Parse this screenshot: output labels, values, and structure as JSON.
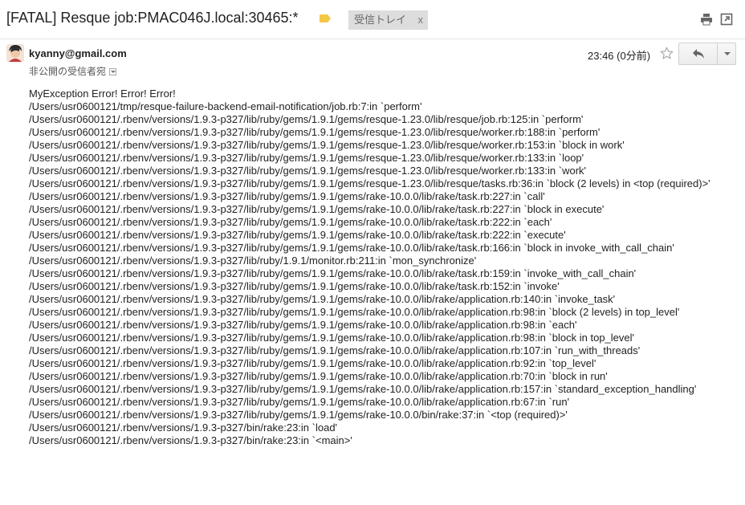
{
  "header": {
    "subject": "[FATAL] Resque job:PMAC046J.local:30465:*",
    "label_chip": "受信トレイ",
    "label_chip_close": "x",
    "colors": {
      "label_tag": "#f6c744",
      "chip_bg": "#dddddd"
    }
  },
  "toolbar": {
    "print_icon": "print-icon",
    "newwin_icon": "open-in-new-window-icon"
  },
  "message": {
    "sender": "kyanny@gmail.com",
    "recipient": "非公開の受信者宛",
    "timestamp": "23:46 (0分前)",
    "star_icon": "star-outline-icon",
    "reply_icon": "reply-arrow-icon",
    "more_icon": "chevron-down-icon",
    "body_lines": [
      "MyException Error! Error! Error!",
      "/Users/usr0600121/tmp/resque-failure-backend-email-notification/job.rb:7:in `perform'",
      "/Users/usr0600121/.rbenv/versions/1.9.3-p327/lib/ruby/gems/1.9.1/gems/resque-1.23.0/lib/resque/job.rb:125:in `perform'",
      "/Users/usr0600121/.rbenv/versions/1.9.3-p327/lib/ruby/gems/1.9.1/gems/resque-1.23.0/lib/resque/worker.rb:188:in `perform'",
      "/Users/usr0600121/.rbenv/versions/1.9.3-p327/lib/ruby/gems/1.9.1/gems/resque-1.23.0/lib/resque/worker.rb:153:in `block in work'",
      "/Users/usr0600121/.rbenv/versions/1.9.3-p327/lib/ruby/gems/1.9.1/gems/resque-1.23.0/lib/resque/worker.rb:133:in `loop'",
      "/Users/usr0600121/.rbenv/versions/1.9.3-p327/lib/ruby/gems/1.9.1/gems/resque-1.23.0/lib/resque/worker.rb:133:in `work'",
      "/Users/usr0600121/.rbenv/versions/1.9.3-p327/lib/ruby/gems/1.9.1/gems/resque-1.23.0/lib/resque/tasks.rb:36:in `block (2 levels) in <top (required)>'",
      "/Users/usr0600121/.rbenv/versions/1.9.3-p327/lib/ruby/gems/1.9.1/gems/rake-10.0.0/lib/rake/task.rb:227:in `call'",
      "/Users/usr0600121/.rbenv/versions/1.9.3-p327/lib/ruby/gems/1.9.1/gems/rake-10.0.0/lib/rake/task.rb:227:in `block in execute'",
      "/Users/usr0600121/.rbenv/versions/1.9.3-p327/lib/ruby/gems/1.9.1/gems/rake-10.0.0/lib/rake/task.rb:222:in `each'",
      "/Users/usr0600121/.rbenv/versions/1.9.3-p327/lib/ruby/gems/1.9.1/gems/rake-10.0.0/lib/rake/task.rb:222:in `execute'",
      "/Users/usr0600121/.rbenv/versions/1.9.3-p327/lib/ruby/gems/1.9.1/gems/rake-10.0.0/lib/rake/task.rb:166:in `block in invoke_with_call_chain'",
      "/Users/usr0600121/.rbenv/versions/1.9.3-p327/lib/ruby/1.9.1/monitor.rb:211:in `mon_synchronize'",
      "/Users/usr0600121/.rbenv/versions/1.9.3-p327/lib/ruby/gems/1.9.1/gems/rake-10.0.0/lib/rake/task.rb:159:in `invoke_with_call_chain'",
      "/Users/usr0600121/.rbenv/versions/1.9.3-p327/lib/ruby/gems/1.9.1/gems/rake-10.0.0/lib/rake/task.rb:152:in `invoke'",
      "/Users/usr0600121/.rbenv/versions/1.9.3-p327/lib/ruby/gems/1.9.1/gems/rake-10.0.0/lib/rake/application.rb:140:in `invoke_task'",
      "/Users/usr0600121/.rbenv/versions/1.9.3-p327/lib/ruby/gems/1.9.1/gems/rake-10.0.0/lib/rake/application.rb:98:in `block (2 levels) in top_level'",
      "/Users/usr0600121/.rbenv/versions/1.9.3-p327/lib/ruby/gems/1.9.1/gems/rake-10.0.0/lib/rake/application.rb:98:in `each'",
      "/Users/usr0600121/.rbenv/versions/1.9.3-p327/lib/ruby/gems/1.9.1/gems/rake-10.0.0/lib/rake/application.rb:98:in `block in top_level'",
      "/Users/usr0600121/.rbenv/versions/1.9.3-p327/lib/ruby/gems/1.9.1/gems/rake-10.0.0/lib/rake/application.rb:107:in `run_with_threads'",
      "/Users/usr0600121/.rbenv/versions/1.9.3-p327/lib/ruby/gems/1.9.1/gems/rake-10.0.0/lib/rake/application.rb:92:in `top_level'",
      "/Users/usr0600121/.rbenv/versions/1.9.3-p327/lib/ruby/gems/1.9.1/gems/rake-10.0.0/lib/rake/application.rb:70:in `block in run'",
      "/Users/usr0600121/.rbenv/versions/1.9.3-p327/lib/ruby/gems/1.9.1/gems/rake-10.0.0/lib/rake/application.rb:157:in `standard_exception_handling'",
      "/Users/usr0600121/.rbenv/versions/1.9.3-p327/lib/ruby/gems/1.9.1/gems/rake-10.0.0/lib/rake/application.rb:67:in `run'",
      "/Users/usr0600121/.rbenv/versions/1.9.3-p327/lib/ruby/gems/1.9.1/gems/rake-10.0.0/bin/rake:37:in `<top (required)>'",
      "/Users/usr0600121/.rbenv/versions/1.9.3-p327/bin/rake:23:in `load'",
      "/Users/usr0600121/.rbenv/versions/1.9.3-p327/bin/rake:23:in `<main>'"
    ]
  }
}
